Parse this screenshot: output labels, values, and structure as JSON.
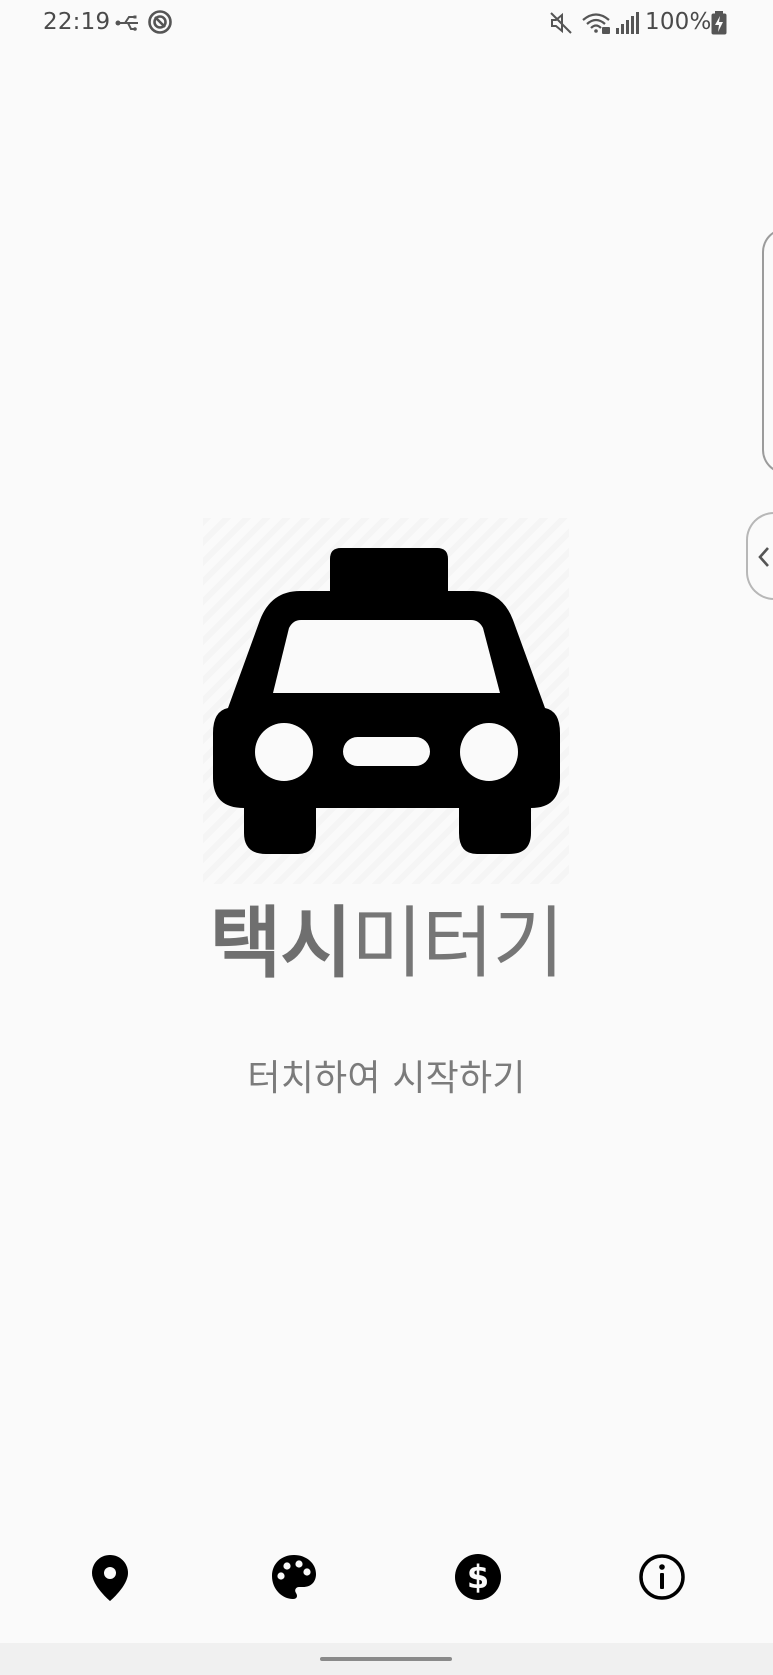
{
  "status_bar": {
    "time": "22:19",
    "battery_text": "100%",
    "icons": [
      "usb-icon",
      "data-saver-icon",
      "mute-icon",
      "wifi-icon",
      "signal-icon",
      "battery-charging-icon"
    ]
  },
  "splash": {
    "title_bold": "택시",
    "title_light": "미터기",
    "hint": "터치하여 시작하기",
    "hero_icon": "taxi-icon"
  },
  "bottom_nav": {
    "items": [
      {
        "icon": "location-pin-icon"
      },
      {
        "icon": "palette-icon"
      },
      {
        "icon": "dollar-icon"
      },
      {
        "icon": "info-icon"
      }
    ]
  },
  "colors": {
    "background": "#fafafa",
    "title": "#767676",
    "hint": "#7b7b7b",
    "icon": "#000000"
  }
}
